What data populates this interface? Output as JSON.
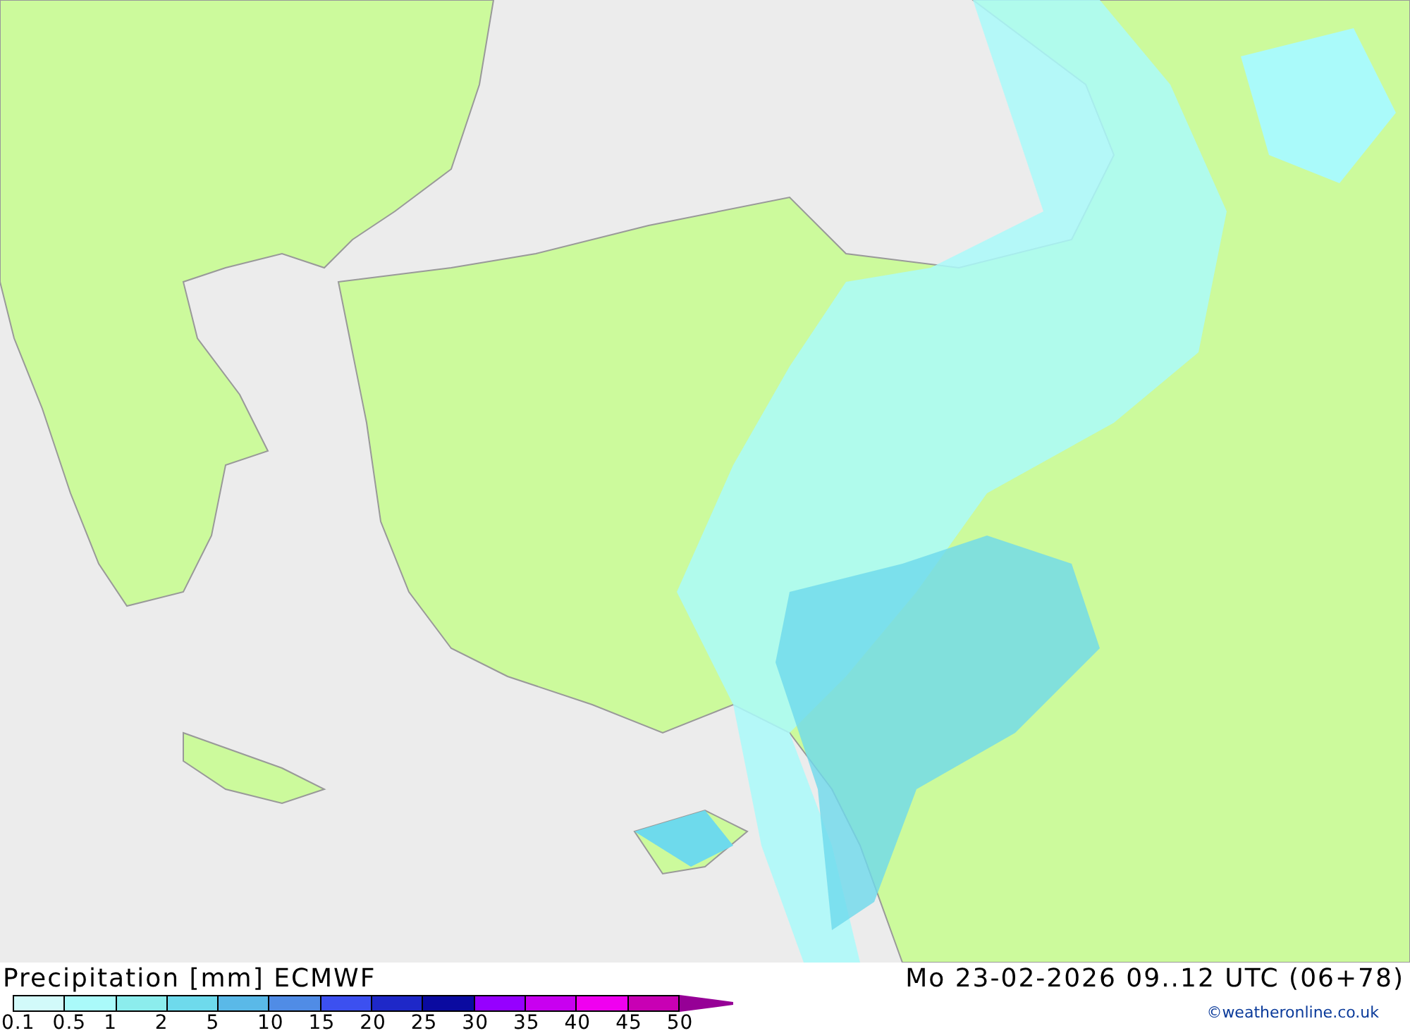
{
  "map": {
    "title": "Precipitation [mm] ECMWF",
    "valid_time": "Mo 23-02-2026 09..12 UTC (06+78)"
  },
  "legend": {
    "swatches": [
      {
        "kind": "bin",
        "color": "#d2fafa"
      },
      {
        "kind": "bin",
        "color": "#aafafa"
      },
      {
        "kind": "bin",
        "color": "#8ceded"
      },
      {
        "kind": "bin",
        "color": "#6edaec"
      },
      {
        "kind": "bin",
        "color": "#5ab9e8"
      },
      {
        "kind": "bin",
        "color": "#508ce6"
      },
      {
        "kind": "bin",
        "color": "#3c50f0"
      },
      {
        "kind": "bin",
        "color": "#1e28c8"
      },
      {
        "kind": "bin",
        "color": "#0a0aa0"
      },
      {
        "kind": "bin",
        "color": "#9600ff"
      },
      {
        "kind": "bin",
        "color": "#c800f0"
      },
      {
        "kind": "bin",
        "color": "#f000f0"
      },
      {
        "kind": "bin",
        "color": "#c800b4"
      },
      {
        "kind": "arrow",
        "color": "#960096"
      }
    ],
    "ticks": [
      "0.1",
      "0.5",
      "1",
      "2",
      "5",
      "10",
      "15",
      "20",
      "25",
      "30",
      "35",
      "40",
      "45",
      "50"
    ]
  },
  "copyright": "©weatheronline.co.uk"
}
